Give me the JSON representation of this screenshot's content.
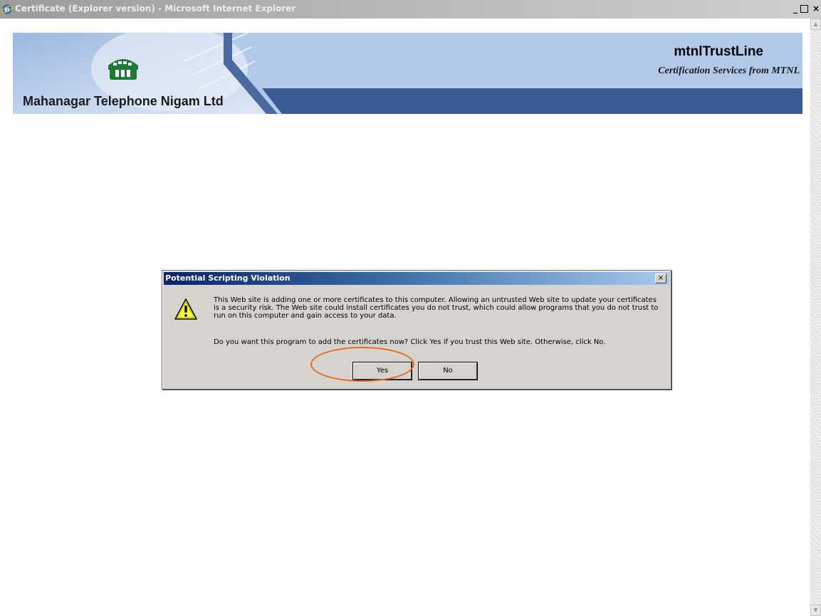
{
  "window": {
    "title": "Certificate (Explorer version) - Microsoft Internet Explorer",
    "controls": {
      "minimize": "_",
      "close": "×"
    }
  },
  "banner": {
    "company_name": "Mahanagar Telephone Nigam Ltd",
    "brand_name": "mtnlTrustLine",
    "tagline": "Certification Services from MTNL"
  },
  "dialog": {
    "title": "Potential Scripting Violation",
    "message": "This Web site is adding one or more certificates to this computer. Allowing an untrusted Web site to update your certificates is a security risk. The Web site could install certificates you do not trust, which could allow programs that you do not trust to run on this computer and gain access to your data.",
    "question": "Do you want this program to add the certificates now? Click Yes if you trust this Web site. Otherwise, click No.",
    "yes_label": "Yes",
    "no_label": "No",
    "close_glyph": "×"
  },
  "scrollbar": {
    "up_glyph": "▲",
    "down_glyph": "▼"
  },
  "colors": {
    "banner_dark_blue": "#3a5c95",
    "banner_light_blue": "#b3c9ea",
    "dialog_face": "#d6d3ce",
    "annotation_orange": "#e86a1a"
  },
  "icons": [
    "ie-icon",
    "mtnl-logo-icon",
    "warning-icon",
    "close-icon"
  ]
}
